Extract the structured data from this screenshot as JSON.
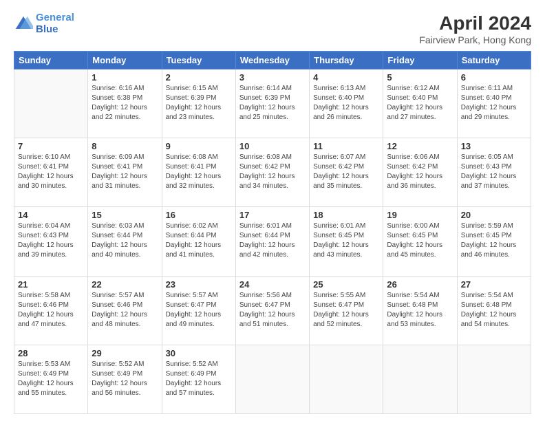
{
  "header": {
    "logo_line1": "General",
    "logo_line2": "Blue",
    "title": "April 2024",
    "subtitle": "Fairview Park, Hong Kong"
  },
  "days_of_week": [
    "Sunday",
    "Monday",
    "Tuesday",
    "Wednesday",
    "Thursday",
    "Friday",
    "Saturday"
  ],
  "weeks": [
    [
      {
        "day": "",
        "info": ""
      },
      {
        "day": "1",
        "info": "Sunrise: 6:16 AM\nSunset: 6:38 PM\nDaylight: 12 hours\nand 22 minutes."
      },
      {
        "day": "2",
        "info": "Sunrise: 6:15 AM\nSunset: 6:39 PM\nDaylight: 12 hours\nand 23 minutes."
      },
      {
        "day": "3",
        "info": "Sunrise: 6:14 AM\nSunset: 6:39 PM\nDaylight: 12 hours\nand 25 minutes."
      },
      {
        "day": "4",
        "info": "Sunrise: 6:13 AM\nSunset: 6:40 PM\nDaylight: 12 hours\nand 26 minutes."
      },
      {
        "day": "5",
        "info": "Sunrise: 6:12 AM\nSunset: 6:40 PM\nDaylight: 12 hours\nand 27 minutes."
      },
      {
        "day": "6",
        "info": "Sunrise: 6:11 AM\nSunset: 6:40 PM\nDaylight: 12 hours\nand 29 minutes."
      }
    ],
    [
      {
        "day": "7",
        "info": "Sunrise: 6:10 AM\nSunset: 6:41 PM\nDaylight: 12 hours\nand 30 minutes."
      },
      {
        "day": "8",
        "info": "Sunrise: 6:09 AM\nSunset: 6:41 PM\nDaylight: 12 hours\nand 31 minutes."
      },
      {
        "day": "9",
        "info": "Sunrise: 6:08 AM\nSunset: 6:41 PM\nDaylight: 12 hours\nand 32 minutes."
      },
      {
        "day": "10",
        "info": "Sunrise: 6:08 AM\nSunset: 6:42 PM\nDaylight: 12 hours\nand 34 minutes."
      },
      {
        "day": "11",
        "info": "Sunrise: 6:07 AM\nSunset: 6:42 PM\nDaylight: 12 hours\nand 35 minutes."
      },
      {
        "day": "12",
        "info": "Sunrise: 6:06 AM\nSunset: 6:42 PM\nDaylight: 12 hours\nand 36 minutes."
      },
      {
        "day": "13",
        "info": "Sunrise: 6:05 AM\nSunset: 6:43 PM\nDaylight: 12 hours\nand 37 minutes."
      }
    ],
    [
      {
        "day": "14",
        "info": "Sunrise: 6:04 AM\nSunset: 6:43 PM\nDaylight: 12 hours\nand 39 minutes."
      },
      {
        "day": "15",
        "info": "Sunrise: 6:03 AM\nSunset: 6:44 PM\nDaylight: 12 hours\nand 40 minutes."
      },
      {
        "day": "16",
        "info": "Sunrise: 6:02 AM\nSunset: 6:44 PM\nDaylight: 12 hours\nand 41 minutes."
      },
      {
        "day": "17",
        "info": "Sunrise: 6:01 AM\nSunset: 6:44 PM\nDaylight: 12 hours\nand 42 minutes."
      },
      {
        "day": "18",
        "info": "Sunrise: 6:01 AM\nSunset: 6:45 PM\nDaylight: 12 hours\nand 43 minutes."
      },
      {
        "day": "19",
        "info": "Sunrise: 6:00 AM\nSunset: 6:45 PM\nDaylight: 12 hours\nand 45 minutes."
      },
      {
        "day": "20",
        "info": "Sunrise: 5:59 AM\nSunset: 6:45 PM\nDaylight: 12 hours\nand 46 minutes."
      }
    ],
    [
      {
        "day": "21",
        "info": "Sunrise: 5:58 AM\nSunset: 6:46 PM\nDaylight: 12 hours\nand 47 minutes."
      },
      {
        "day": "22",
        "info": "Sunrise: 5:57 AM\nSunset: 6:46 PM\nDaylight: 12 hours\nand 48 minutes."
      },
      {
        "day": "23",
        "info": "Sunrise: 5:57 AM\nSunset: 6:47 PM\nDaylight: 12 hours\nand 49 minutes."
      },
      {
        "day": "24",
        "info": "Sunrise: 5:56 AM\nSunset: 6:47 PM\nDaylight: 12 hours\nand 51 minutes."
      },
      {
        "day": "25",
        "info": "Sunrise: 5:55 AM\nSunset: 6:47 PM\nDaylight: 12 hours\nand 52 minutes."
      },
      {
        "day": "26",
        "info": "Sunrise: 5:54 AM\nSunset: 6:48 PM\nDaylight: 12 hours\nand 53 minutes."
      },
      {
        "day": "27",
        "info": "Sunrise: 5:54 AM\nSunset: 6:48 PM\nDaylight: 12 hours\nand 54 minutes."
      }
    ],
    [
      {
        "day": "28",
        "info": "Sunrise: 5:53 AM\nSunset: 6:49 PM\nDaylight: 12 hours\nand 55 minutes."
      },
      {
        "day": "29",
        "info": "Sunrise: 5:52 AM\nSunset: 6:49 PM\nDaylight: 12 hours\nand 56 minutes."
      },
      {
        "day": "30",
        "info": "Sunrise: 5:52 AM\nSunset: 6:49 PM\nDaylight: 12 hours\nand 57 minutes."
      },
      {
        "day": "",
        "info": ""
      },
      {
        "day": "",
        "info": ""
      },
      {
        "day": "",
        "info": ""
      },
      {
        "day": "",
        "info": ""
      }
    ]
  ]
}
